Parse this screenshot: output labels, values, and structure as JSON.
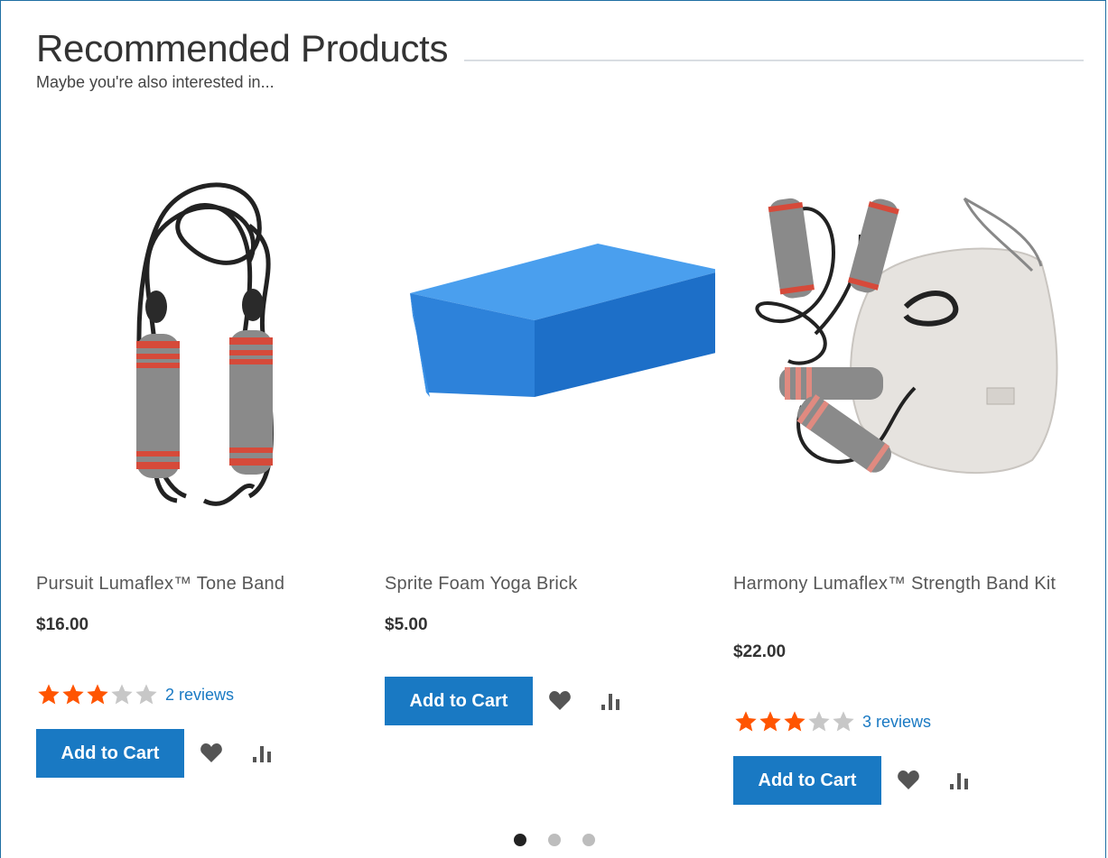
{
  "header": {
    "title": "Recommended Products",
    "subtitle": "Maybe you're also interested in..."
  },
  "products": [
    {
      "name": "Pursuit Lumaflex™ Tone Band",
      "price": "$16.00",
      "rating": 3,
      "rating_max": 5,
      "reviews_label": "2 reviews",
      "add_to_cart_label": "Add to Cart",
      "image": "jump-rope"
    },
    {
      "name": "Sprite Foam Yoga Brick",
      "price": "$5.00",
      "rating": null,
      "reviews_label": "",
      "add_to_cart_label": "Add to Cart",
      "image": "yoga-brick"
    },
    {
      "name": "Harmony Lumaflex™ Strength Band Kit",
      "price": "$22.00",
      "rating": 3,
      "rating_max": 5,
      "reviews_label": "3 reviews",
      "add_to_cart_label": "Add to Cart",
      "image": "band-kit"
    }
  ],
  "icons": {
    "wishlist": "heart-icon",
    "compare": "compare-bars-icon",
    "rating": "star-icon"
  },
  "colors": {
    "accent": "#1979c3",
    "star_filled": "#ff5501",
    "star_empty": "#c7c7c7",
    "frame_border": "#1f6fa3"
  },
  "pagination": {
    "count": 3,
    "active_index": 0
  }
}
